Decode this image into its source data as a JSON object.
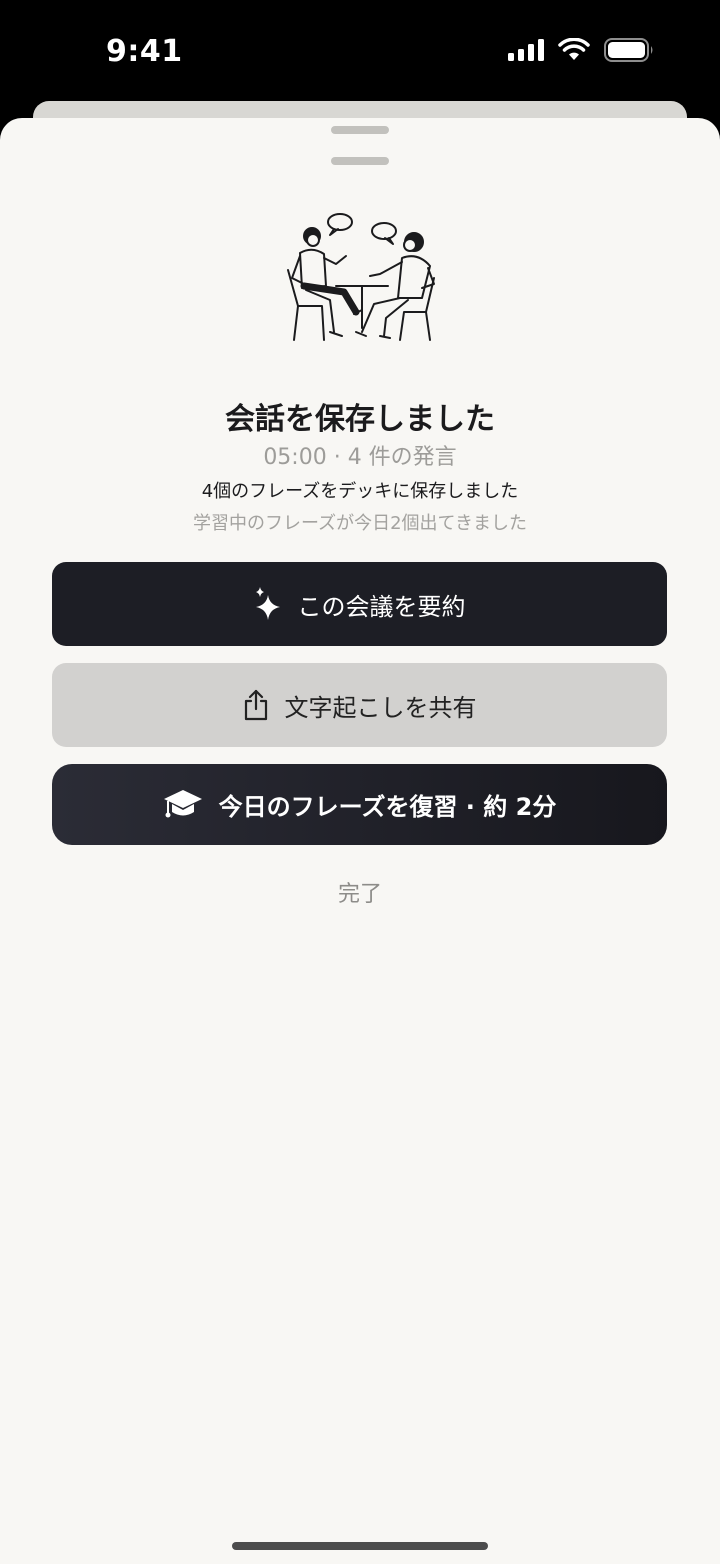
{
  "status_bar": {
    "time": "9:41",
    "icons": [
      "cellular-signal-icon",
      "wifi-icon",
      "battery-icon"
    ]
  },
  "sheet": {
    "title": "会話を保存しました",
    "meta": "05:00 · 4 件の発言",
    "saved_message": "4個のフレーズをデッキに保存しました",
    "learning_message": "学習中のフレーズが今日2個出てきました",
    "actions": {
      "summarize_label": "この会議を要約",
      "share_label": "文字起こしを共有",
      "review_label": "今日のフレーズを復習 · 約 2分"
    },
    "done_label": "完了"
  },
  "colors": {
    "primary_button": "#1d1e25",
    "secondary_button": "#d2d1cf",
    "sheet_background": "#f8f7f4"
  }
}
